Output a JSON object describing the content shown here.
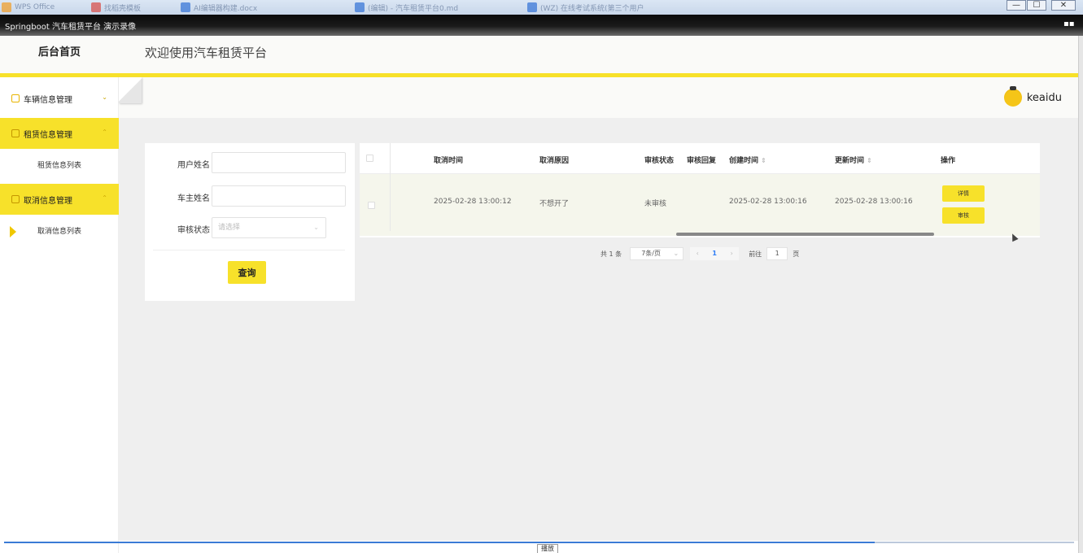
{
  "os": {
    "tabs": [
      {
        "label": "WPS Office",
        "icon": "wps-icon"
      },
      {
        "label": "找稻壳模板",
        "icon": "docer-icon"
      },
      {
        "label": "AI编辑器构建.docx",
        "icon": "doc-icon"
      },
      {
        "label": "(编辑) - 汽车租赁平台0.md",
        "icon": "doc-icon"
      },
      {
        "label": "(WZ) 在线考试系统(第三个用户",
        "icon": "doc-icon"
      }
    ],
    "controls": {
      "minimize": "—",
      "maximize": "☐",
      "close": "✕"
    }
  },
  "player": {
    "title": "Springboot 汽车租赁平台 演示录像",
    "play_label": "播放"
  },
  "header": {
    "home_title": "后台首页",
    "welcome": "欢迎使用汽车租赁平台"
  },
  "user": {
    "name": "keaidu"
  },
  "sidebar": {
    "items": [
      {
        "label": "车辆信息管理",
        "chevron": "⌄"
      },
      {
        "label": "租赁信息管理",
        "chevron": "⌃"
      },
      {
        "label": "租赁信息列表"
      },
      {
        "label": "取消信息管理",
        "chevron": "⌃"
      },
      {
        "label": "取消信息列表"
      }
    ]
  },
  "search": {
    "user_name_label": "用户姓名",
    "owner_name_label": "车主姓名",
    "audit_status_label": "审核状态",
    "audit_status_placeholder": "请选择",
    "query_button": "查询"
  },
  "table": {
    "columns": [
      "取消时间",
      "取消原因",
      "审核状态",
      "审核回复",
      "创建时间",
      "更新时间",
      "操作"
    ],
    "sort_icon": "⇕",
    "rows": [
      {
        "cancel_time": "2025-02-28 13:00:12",
        "cancel_reason": "不想开了",
        "audit_status": "未审核",
        "audit_reply": "",
        "created_time": "2025-02-28 13:00:16",
        "updated_time": "2025-02-28 13:00:16",
        "actions": [
          "详情",
          "审核"
        ]
      }
    ]
  },
  "pagination": {
    "total": "共 1 条",
    "page_size": "7条/页",
    "current_page": "1",
    "goto_label": "前往",
    "goto_value": "1",
    "page_unit": "页"
  },
  "colors": {
    "accent": "#f7e12a",
    "sidebar_active": "#f7e12a",
    "link_blue": "#2d7cf6"
  }
}
